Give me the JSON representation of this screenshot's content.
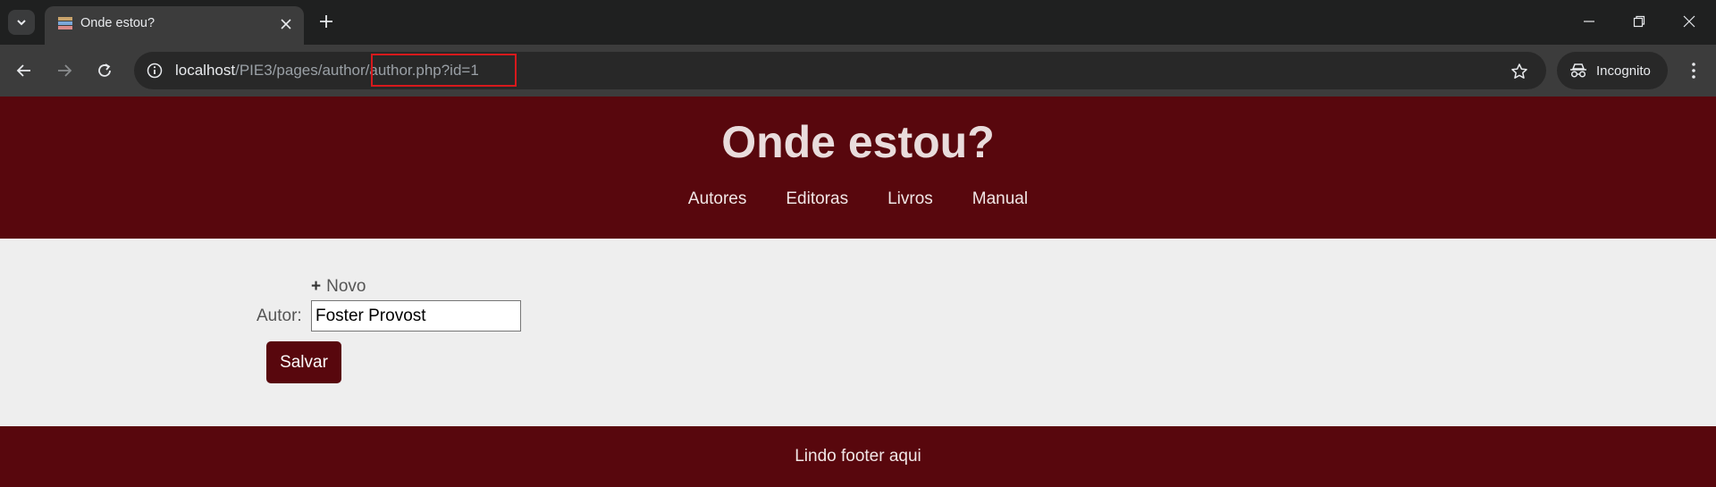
{
  "browser": {
    "tab_title": "Onde estou?",
    "url_host": "localhost",
    "url_path": "/PIE3/pages/author/author.php?id=1",
    "incognito_label": "Incognito"
  },
  "site": {
    "title": "Onde estou?",
    "nav": [
      "Autores",
      "Editoras",
      "Livros",
      "Manual"
    ]
  },
  "form": {
    "new_plus": "+",
    "new_label": "Novo",
    "author_label": "Autor:",
    "author_value": "Foster Provost",
    "save_label": "Salvar"
  },
  "footer": {
    "text": "Lindo footer aqui"
  },
  "colors": {
    "brand": "#58070d",
    "background": "#eeeeee",
    "highlight": "#d7191c"
  }
}
